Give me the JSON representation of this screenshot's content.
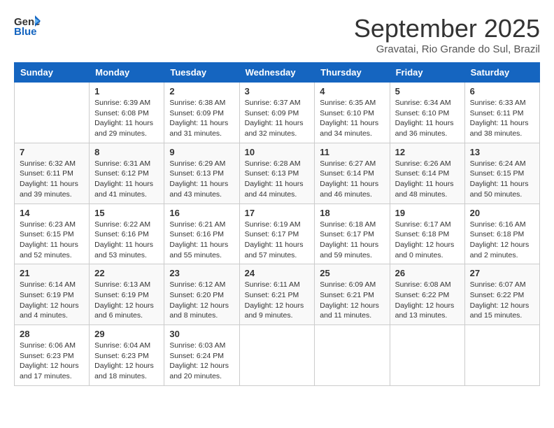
{
  "header": {
    "logo_line1": "General",
    "logo_line2": "Blue",
    "month": "September 2025",
    "location": "Gravatai, Rio Grande do Sul, Brazil"
  },
  "days_of_week": [
    "Sunday",
    "Monday",
    "Tuesday",
    "Wednesday",
    "Thursday",
    "Friday",
    "Saturday"
  ],
  "weeks": [
    [
      {
        "day": "",
        "sunrise": "",
        "sunset": "",
        "daylight": ""
      },
      {
        "day": "1",
        "sunrise": "Sunrise: 6:39 AM",
        "sunset": "Sunset: 6:08 PM",
        "daylight": "Daylight: 11 hours and 29 minutes."
      },
      {
        "day": "2",
        "sunrise": "Sunrise: 6:38 AM",
        "sunset": "Sunset: 6:09 PM",
        "daylight": "Daylight: 11 hours and 31 minutes."
      },
      {
        "day": "3",
        "sunrise": "Sunrise: 6:37 AM",
        "sunset": "Sunset: 6:09 PM",
        "daylight": "Daylight: 11 hours and 32 minutes."
      },
      {
        "day": "4",
        "sunrise": "Sunrise: 6:35 AM",
        "sunset": "Sunset: 6:10 PM",
        "daylight": "Daylight: 11 hours and 34 minutes."
      },
      {
        "day": "5",
        "sunrise": "Sunrise: 6:34 AM",
        "sunset": "Sunset: 6:10 PM",
        "daylight": "Daylight: 11 hours and 36 minutes."
      },
      {
        "day": "6",
        "sunrise": "Sunrise: 6:33 AM",
        "sunset": "Sunset: 6:11 PM",
        "daylight": "Daylight: 11 hours and 38 minutes."
      }
    ],
    [
      {
        "day": "7",
        "sunrise": "Sunrise: 6:32 AM",
        "sunset": "Sunset: 6:11 PM",
        "daylight": "Daylight: 11 hours and 39 minutes."
      },
      {
        "day": "8",
        "sunrise": "Sunrise: 6:31 AM",
        "sunset": "Sunset: 6:12 PM",
        "daylight": "Daylight: 11 hours and 41 minutes."
      },
      {
        "day": "9",
        "sunrise": "Sunrise: 6:29 AM",
        "sunset": "Sunset: 6:13 PM",
        "daylight": "Daylight: 11 hours and 43 minutes."
      },
      {
        "day": "10",
        "sunrise": "Sunrise: 6:28 AM",
        "sunset": "Sunset: 6:13 PM",
        "daylight": "Daylight: 11 hours and 44 minutes."
      },
      {
        "day": "11",
        "sunrise": "Sunrise: 6:27 AM",
        "sunset": "Sunset: 6:14 PM",
        "daylight": "Daylight: 11 hours and 46 minutes."
      },
      {
        "day": "12",
        "sunrise": "Sunrise: 6:26 AM",
        "sunset": "Sunset: 6:14 PM",
        "daylight": "Daylight: 11 hours and 48 minutes."
      },
      {
        "day": "13",
        "sunrise": "Sunrise: 6:24 AM",
        "sunset": "Sunset: 6:15 PM",
        "daylight": "Daylight: 11 hours and 50 minutes."
      }
    ],
    [
      {
        "day": "14",
        "sunrise": "Sunrise: 6:23 AM",
        "sunset": "Sunset: 6:15 PM",
        "daylight": "Daylight: 11 hours and 52 minutes."
      },
      {
        "day": "15",
        "sunrise": "Sunrise: 6:22 AM",
        "sunset": "Sunset: 6:16 PM",
        "daylight": "Daylight: 11 hours and 53 minutes."
      },
      {
        "day": "16",
        "sunrise": "Sunrise: 6:21 AM",
        "sunset": "Sunset: 6:16 PM",
        "daylight": "Daylight: 11 hours and 55 minutes."
      },
      {
        "day": "17",
        "sunrise": "Sunrise: 6:19 AM",
        "sunset": "Sunset: 6:17 PM",
        "daylight": "Daylight: 11 hours and 57 minutes."
      },
      {
        "day": "18",
        "sunrise": "Sunrise: 6:18 AM",
        "sunset": "Sunset: 6:17 PM",
        "daylight": "Daylight: 11 hours and 59 minutes."
      },
      {
        "day": "19",
        "sunrise": "Sunrise: 6:17 AM",
        "sunset": "Sunset: 6:18 PM",
        "daylight": "Daylight: 12 hours and 0 minutes."
      },
      {
        "day": "20",
        "sunrise": "Sunrise: 6:16 AM",
        "sunset": "Sunset: 6:18 PM",
        "daylight": "Daylight: 12 hours and 2 minutes."
      }
    ],
    [
      {
        "day": "21",
        "sunrise": "Sunrise: 6:14 AM",
        "sunset": "Sunset: 6:19 PM",
        "daylight": "Daylight: 12 hours and 4 minutes."
      },
      {
        "day": "22",
        "sunrise": "Sunrise: 6:13 AM",
        "sunset": "Sunset: 6:19 PM",
        "daylight": "Daylight: 12 hours and 6 minutes."
      },
      {
        "day": "23",
        "sunrise": "Sunrise: 6:12 AM",
        "sunset": "Sunset: 6:20 PM",
        "daylight": "Daylight: 12 hours and 8 minutes."
      },
      {
        "day": "24",
        "sunrise": "Sunrise: 6:11 AM",
        "sunset": "Sunset: 6:21 PM",
        "daylight": "Daylight: 12 hours and 9 minutes."
      },
      {
        "day": "25",
        "sunrise": "Sunrise: 6:09 AM",
        "sunset": "Sunset: 6:21 PM",
        "daylight": "Daylight: 12 hours and 11 minutes."
      },
      {
        "day": "26",
        "sunrise": "Sunrise: 6:08 AM",
        "sunset": "Sunset: 6:22 PM",
        "daylight": "Daylight: 12 hours and 13 minutes."
      },
      {
        "day": "27",
        "sunrise": "Sunrise: 6:07 AM",
        "sunset": "Sunset: 6:22 PM",
        "daylight": "Daylight: 12 hours and 15 minutes."
      }
    ],
    [
      {
        "day": "28",
        "sunrise": "Sunrise: 6:06 AM",
        "sunset": "Sunset: 6:23 PM",
        "daylight": "Daylight: 12 hours and 17 minutes."
      },
      {
        "day": "29",
        "sunrise": "Sunrise: 6:04 AM",
        "sunset": "Sunset: 6:23 PM",
        "daylight": "Daylight: 12 hours and 18 minutes."
      },
      {
        "day": "30",
        "sunrise": "Sunrise: 6:03 AM",
        "sunset": "Sunset: 6:24 PM",
        "daylight": "Daylight: 12 hours and 20 minutes."
      },
      {
        "day": "",
        "sunrise": "",
        "sunset": "",
        "daylight": ""
      },
      {
        "day": "",
        "sunrise": "",
        "sunset": "",
        "daylight": ""
      },
      {
        "day": "",
        "sunrise": "",
        "sunset": "",
        "daylight": ""
      },
      {
        "day": "",
        "sunrise": "",
        "sunset": "",
        "daylight": ""
      }
    ]
  ]
}
